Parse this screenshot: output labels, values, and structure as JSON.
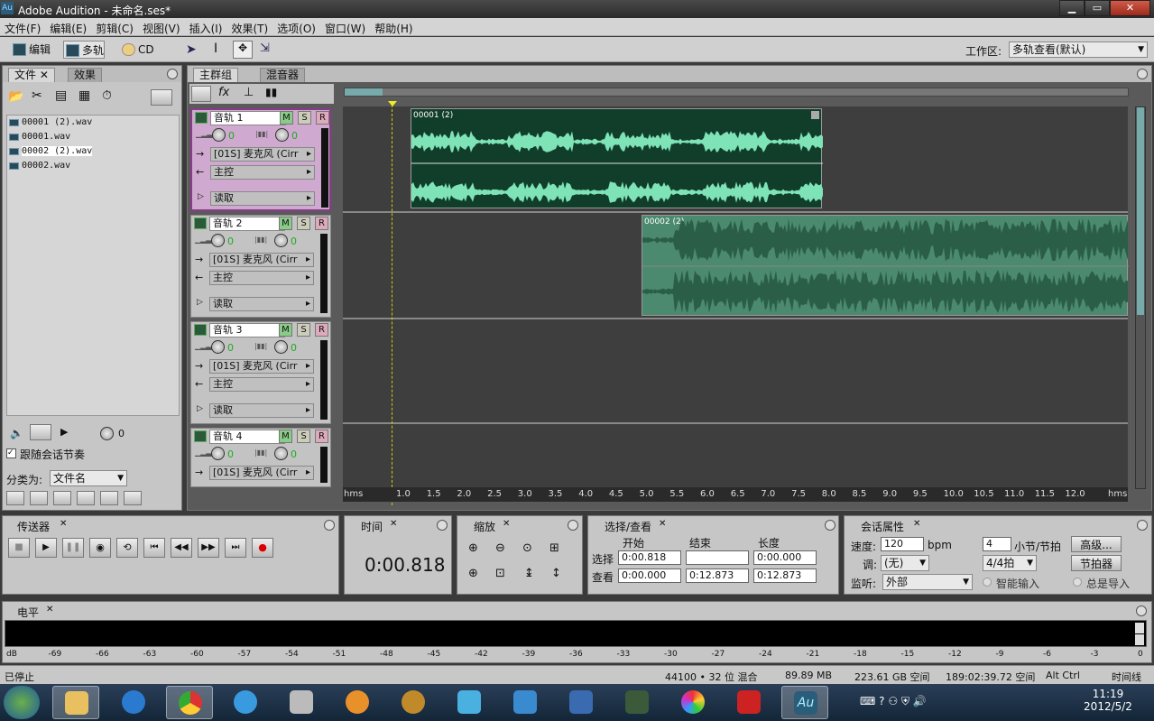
{
  "window": {
    "title": "Adobe Audition - 未命名.ses*",
    "logo": "Au"
  },
  "menu": [
    "文件(F)",
    "编辑(E)",
    "剪辑(C)",
    "视图(V)",
    "插入(I)",
    "效果(T)",
    "选项(O)",
    "窗口(W)",
    "帮助(H)"
  ],
  "toolbar": {
    "edit": "编辑",
    "multitrack": "多轨",
    "cd": "CD",
    "workspace_label": "工作区:",
    "workspace_value": "多轨查看(默认)"
  },
  "files_panel": {
    "tab_files": "文件",
    "tab_effects": "效果",
    "files": [
      "00001 (2).wav",
      "00001.wav",
      "00002 (2).wav",
      "00002.wav"
    ],
    "follow_label": "跟随会话节奏",
    "sort_label": "分类为:",
    "sort_value": "文件名",
    "volume_value": "0"
  },
  "main_panel": {
    "tab_main": "主群组",
    "tab_mixer": "混音器"
  },
  "tracks": [
    {
      "name": "音轨 1",
      "vol": "0",
      "pan": "0",
      "input": "[01S] 麦克风 (Cirr",
      "output": "主控",
      "mode": "读取"
    },
    {
      "name": "音轨 2",
      "vol": "0",
      "pan": "0",
      "input": "[01S] 麦克风 (Cirr",
      "output": "主控",
      "mode": "读取"
    },
    {
      "name": "音轨 3",
      "vol": "0",
      "pan": "0",
      "input": "[01S] 麦克风 (Cirr",
      "output": "主控",
      "mode": "读取"
    },
    {
      "name": "音轨 4",
      "vol": "0",
      "pan": "0",
      "input": "[01S] 麦克风 (Cirr"
    }
  ],
  "msr": {
    "m": "M",
    "s": "S",
    "r": "R"
  },
  "clips": {
    "clip1": "00001 (2)",
    "clip2": "00002 (2)"
  },
  "ruler": {
    "unit": "hms",
    "ticks": [
      "1.0",
      "1.5",
      "2.0",
      "2.5",
      "3.0",
      "3.5",
      "4.0",
      "4.5",
      "5.0",
      "5.5",
      "6.0",
      "6.5",
      "7.0",
      "7.5",
      "8.0",
      "8.5",
      "9.0",
      "9.5",
      "10.0",
      "10.5",
      "11.0",
      "11.5",
      "12.0"
    ]
  },
  "transport": {
    "title": "传送器"
  },
  "time": {
    "title": "时间",
    "value": "0:00.818"
  },
  "zoom": {
    "title": "缩放"
  },
  "selection": {
    "title": "选择/查看",
    "col_start": "开始",
    "col_end": "结束",
    "col_length": "长度",
    "row_select": "选择",
    "row_view": "查看",
    "sel_start": "0:00.818",
    "sel_end": "",
    "sel_length": "0:00.000",
    "view_start": "0:00.000",
    "view_end": "0:12.873",
    "view_length": "0:12.873"
  },
  "session": {
    "title": "会话属性",
    "tempo_label": "速度:",
    "tempo": "120",
    "bpm": "bpm",
    "beats": "4",
    "bar_beat": "小节/节拍",
    "advanced": "高级...",
    "key_label": "调:",
    "key": "(无)",
    "time_sig": "4/4拍",
    "metronome": "节拍器",
    "monitor_label": "监听:",
    "monitor": "外部",
    "smart_input": "智能输入",
    "always_import": "总是导入"
  },
  "levels": {
    "title": "电平",
    "scale": [
      "dB",
      "-69",
      "-66",
      "-63",
      "-60",
      "-57",
      "-54",
      "-51",
      "-48",
      "-45",
      "-42",
      "-39",
      "-36",
      "-33",
      "-30",
      "-27",
      "-24",
      "-21",
      "-18",
      "-15",
      "-12",
      "-9",
      "-6",
      "-3",
      "0"
    ]
  },
  "status": {
    "state": "已停止",
    "format": "44100 • 32 位 混合",
    "mem": "89.89 MB",
    "disk": "223.61 GB 空间",
    "time_free": "189:02:39.72 空间",
    "keys": "Alt Ctrl",
    "timeline": "时间线"
  },
  "taskbar": {
    "clock_time": "11:19",
    "clock_date": "2012/5/2"
  }
}
